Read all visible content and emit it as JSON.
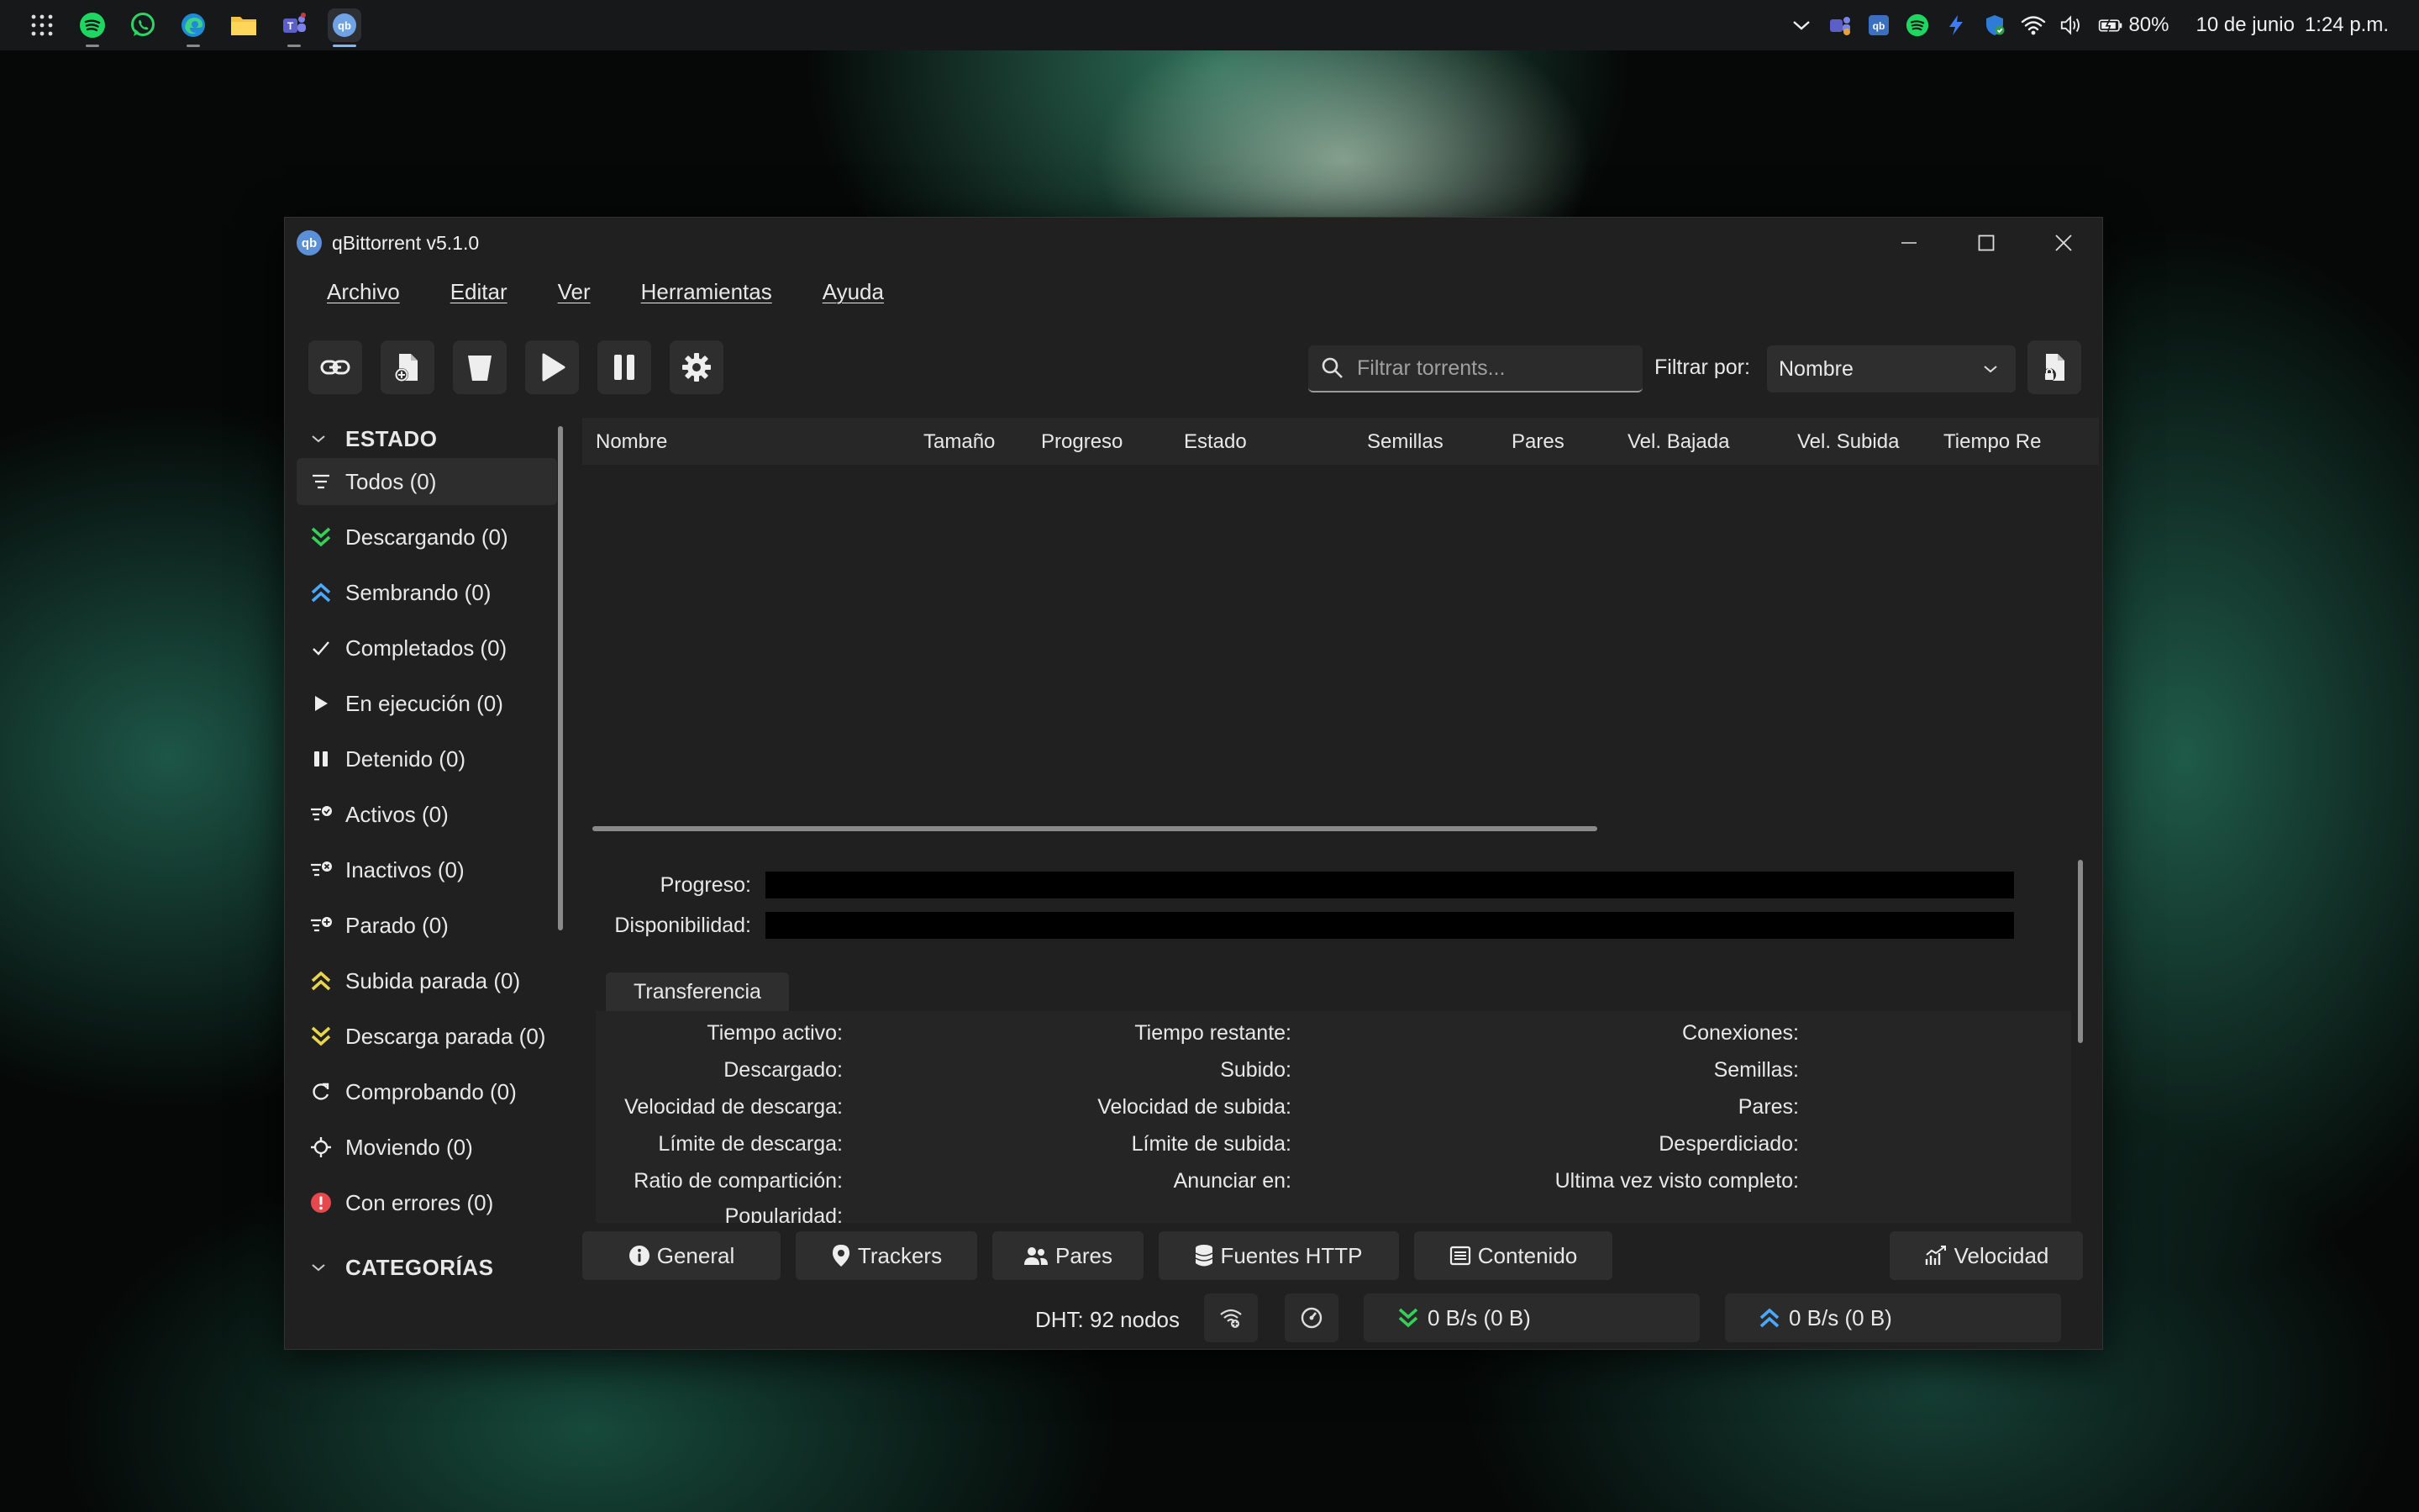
{
  "taskbar": {
    "apps": [
      "apps-grid-icon",
      "spotify-icon",
      "whatsapp-icon",
      "edge-icon",
      "file-explorer-icon",
      "teams-icon",
      "qbittorrent-icon"
    ],
    "battery": "80%",
    "date": "10 de junio",
    "time": "1:24 p.m."
  },
  "window": {
    "title": "qBittorrent v5.1.0",
    "app_icon_text": "qb"
  },
  "menu": [
    "Archivo",
    "Editar",
    "Ver",
    "Herramientas",
    "Ayuda"
  ],
  "toolbar": {
    "search_placeholder": "Filtrar torrents...",
    "filter_label": "Filtrar por:",
    "filter_value": "Nombre"
  },
  "sidebar": {
    "status_header": "ESTADO",
    "categories_header": "CATEGORÍAS",
    "items": [
      {
        "label": "Todos (0)",
        "icon": "filter-icon"
      },
      {
        "label": "Descargando (0)",
        "icon": "download-arrows-icon",
        "color": "#34d058"
      },
      {
        "label": "Sembrando (0)",
        "icon": "upload-arrows-icon",
        "color": "#4aa8ff"
      },
      {
        "label": "Completados (0)",
        "icon": "check-icon"
      },
      {
        "label": "En ejecución (0)",
        "icon": "play-icon"
      },
      {
        "label": "Detenido (0)",
        "icon": "pause-icon"
      },
      {
        "label": "Activos (0)",
        "icon": "filter-check-icon"
      },
      {
        "label": "Inactivos (0)",
        "icon": "filter-x-icon"
      },
      {
        "label": "Parado (0)",
        "icon": "filter-plus-icon"
      },
      {
        "label": "Subida parada (0)",
        "icon": "upload-stalled-icon",
        "color": "#e8d44d"
      },
      {
        "label": "Descarga parada (0)",
        "icon": "download-stalled-icon",
        "color": "#e8d44d"
      },
      {
        "label": "Comprobando (0)",
        "icon": "refresh-icon"
      },
      {
        "label": "Moviendo (0)",
        "icon": "move-icon"
      },
      {
        "label": "Con errores (0)",
        "icon": "error-icon",
        "color": "#e5484d"
      }
    ]
  },
  "table": {
    "columns": [
      "Nombre",
      "Tamaño",
      "Progreso",
      "Estado",
      "Semillas",
      "Pares",
      "Vel. Bajada",
      "Vel. Subida",
      "Tiempo Re"
    ]
  },
  "details": {
    "progress_label": "Progreso:",
    "availability_label": "Disponibilidad:",
    "transfer_tab": "Transferencia",
    "col1": [
      "Tiempo activo:",
      "Descargado:",
      "Velocidad de descarga:",
      "Límite de descarga:",
      "Ratio de compartición:",
      "Popularidad:"
    ],
    "col2": [
      "Tiempo restante:",
      "Subido:",
      "Velocidad de subida:",
      "Límite de subida:",
      "Anunciar en:"
    ],
    "col3": [
      "Conexiones:",
      "Semillas:",
      "Pares:",
      "Desperdiciado:",
      "Ultima vez visto completo:"
    ]
  },
  "bottom_tabs": [
    "General",
    "Trackers",
    "Pares",
    "Fuentes HTTP",
    "Contenido",
    "Velocidad"
  ],
  "statusbar": {
    "dht": "DHT: 92 nodos",
    "download": "0 B/s (0 B)",
    "upload": "0 B/s (0 B)"
  }
}
